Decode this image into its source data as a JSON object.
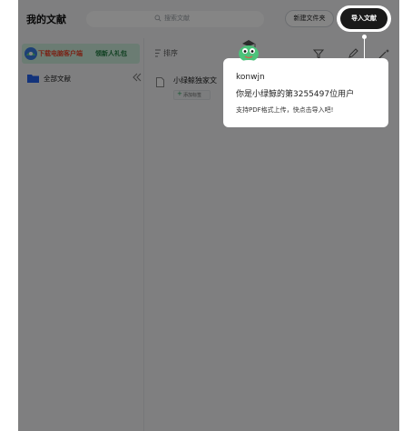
{
  "header": {
    "title": "我的文献",
    "search_placeholder": "搜索文献",
    "new_folder_label": "新建文件夹",
    "import_label": "导入文献"
  },
  "sidebar": {
    "promo_text_1": "下载电脑客户端",
    "promo_text_2": "领新人礼包",
    "all_docs_label": "全部文献"
  },
  "main": {
    "sort_label": "排序",
    "document": {
      "title": "小绿鲸独家文",
      "add_tag_label": "添加标签"
    }
  },
  "tooltip": {
    "username": "konwjn",
    "message": "你是小绿鲸的第3255497位用户",
    "hint": "支持PDF格式上传，快点击导入吧!"
  },
  "colors": {
    "accent_green": "#2aa55a",
    "promo_bg": "#cdeedd",
    "promo_red": "#e8452c",
    "dark_button": "#111111"
  }
}
